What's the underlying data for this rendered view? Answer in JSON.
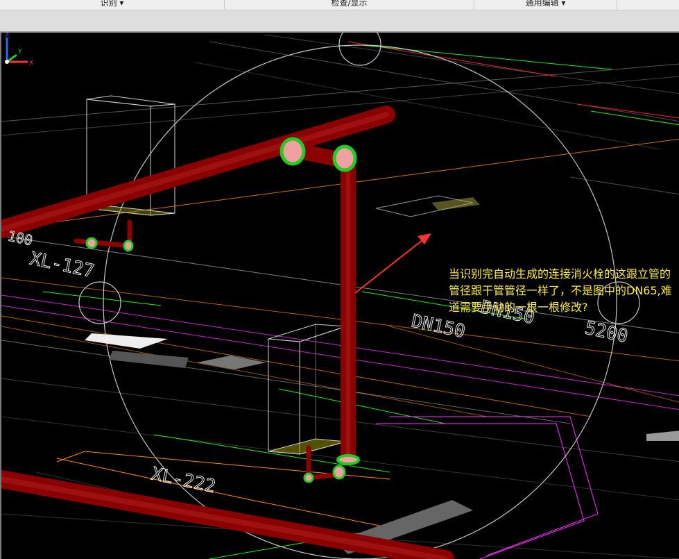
{
  "ribbon": {
    "tabs": [
      {
        "label": "识别 ▾"
      },
      {
        "label": "检查/显示"
      },
      {
        "label": "通用编辑 ▾"
      }
    ]
  },
  "viewport": {
    "annotation": "当识别完自动生成的连接消火栓的这跟立管的管径跟干管管径一样了，不是图中的DN65,难道需要手动的一根一根修改?",
    "drawing_labels": {
      "xl127": "XL-127",
      "xl222": "XL-222",
      "dn150a": "DN150",
      "dn150b": "DN150",
      "dim5200": "5200",
      "dim100": "100"
    },
    "axis": {
      "z": "Z",
      "y": "Y",
      "x": "X"
    }
  },
  "colors": {
    "pipe": "#8b0000",
    "fitting": "#22cc22",
    "annotation_text": "#ffee44",
    "arrow": "#ff3333",
    "orbit_circle": "#c8c8c8"
  }
}
